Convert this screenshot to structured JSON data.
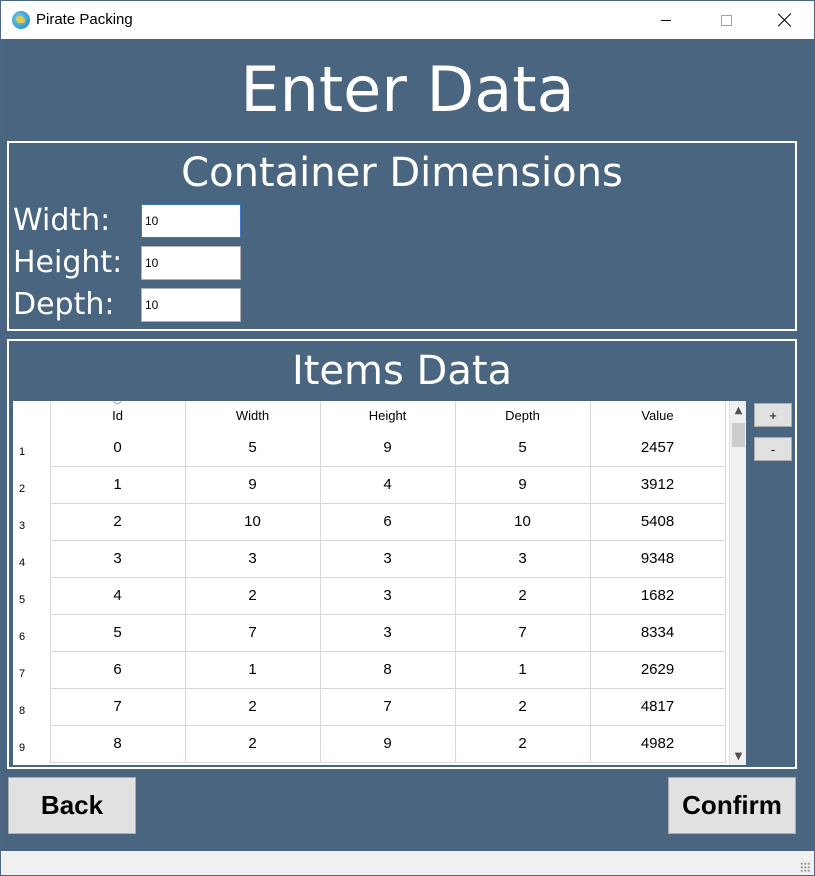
{
  "window": {
    "title": "Pirate Packing"
  },
  "page": {
    "title": "Enter Data"
  },
  "container": {
    "title": "Container Dimensions",
    "width_label": "Width:",
    "width_value": "10",
    "height_label": "Height:",
    "height_value": "10",
    "depth_label": "Depth:",
    "depth_value": "10"
  },
  "items": {
    "title": "Items Data",
    "columns": [
      "Id",
      "Width",
      "Height",
      "Depth",
      "Value"
    ],
    "rows": [
      {
        "num": "1",
        "cells": [
          "0",
          "5",
          "9",
          "5",
          "2457"
        ]
      },
      {
        "num": "2",
        "cells": [
          "1",
          "9",
          "4",
          "9",
          "3912"
        ]
      },
      {
        "num": "3",
        "cells": [
          "2",
          "10",
          "6",
          "10",
          "5408"
        ]
      },
      {
        "num": "4",
        "cells": [
          "3",
          "3",
          "3",
          "3",
          "9348"
        ]
      },
      {
        "num": "5",
        "cells": [
          "4",
          "2",
          "3",
          "2",
          "1682"
        ]
      },
      {
        "num": "6",
        "cells": [
          "5",
          "7",
          "3",
          "7",
          "8334"
        ]
      },
      {
        "num": "7",
        "cells": [
          "6",
          "1",
          "8",
          "1",
          "2629"
        ]
      },
      {
        "num": "8",
        "cells": [
          "7",
          "2",
          "7",
          "2",
          "4817"
        ]
      },
      {
        "num": "9",
        "cells": [
          "8",
          "2",
          "9",
          "2",
          "4982"
        ]
      }
    ],
    "add_label": "+",
    "remove_label": "-"
  },
  "buttons": {
    "back": "Back",
    "confirm": "Confirm"
  },
  "colors": {
    "background": "#4a6580",
    "border": "#ffffff",
    "button": "#e1e1e1"
  }
}
